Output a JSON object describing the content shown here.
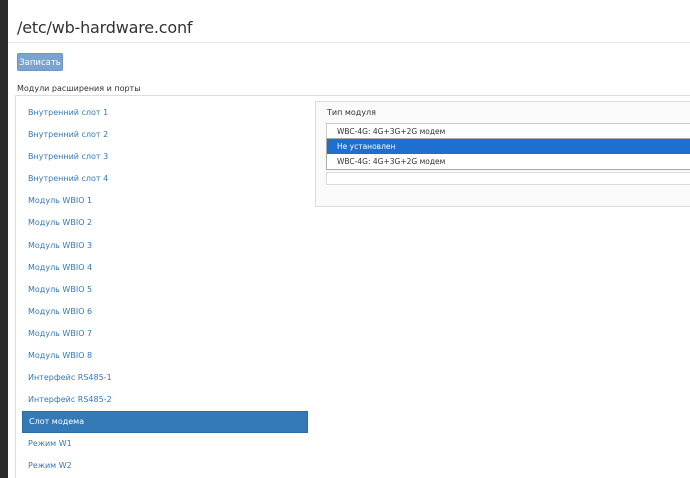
{
  "header": {
    "title": "/etc/wb-hardware.conf"
  },
  "toolbar": {
    "save_label": "Записать"
  },
  "section": {
    "label": "Модули расширения и порты"
  },
  "nav": {
    "items": [
      "Внутренний слот 1",
      "Внутренний слот 2",
      "Внутренний слот 3",
      "Внутренний слот 4",
      "Модуль WBIO 1",
      "Модуль WBIO 2",
      "Модуль WBIO 3",
      "Модуль WBIO 4",
      "Модуль WBIO 5",
      "Модуль WBIO 6",
      "Модуль WBIO 7",
      "Модуль WBIO 8",
      "Интерфейс RS485-1",
      "Интерфейс RS485-2",
      "Слот модема",
      "Режим W1",
      "Режим W2"
    ],
    "active_index": 14
  },
  "form": {
    "field_label": "Тип модуля",
    "selected_value": "WBC-4G: 4G+3G+2G модем",
    "options": [
      "Не установлен",
      "WBC-4G: 4G+3G+2G модем"
    ],
    "highlighted_index": 0
  },
  "colors": {
    "accent": "#337ab7",
    "button": "#7aa3d0",
    "highlight": "#1e6fd0"
  }
}
